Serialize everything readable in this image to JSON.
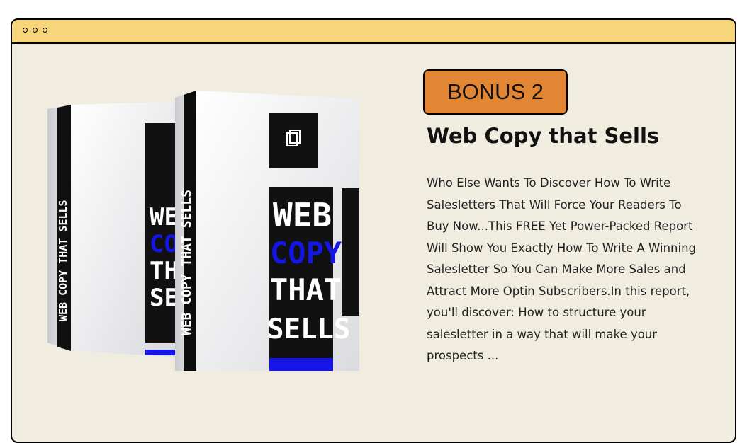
{
  "bonus": {
    "label": "BONUS 2",
    "title": "Web Copy that Sells",
    "description": "Who Else Wants To Discover How To Write Salesletters That Will Force Your Readers To Buy Now...This FREE Yet Power-Packed Report Will Show You Exactly How To Write A Winning Salesletter So You Can Make More Sales and Attract More Optin Subscribers.In this report, you'll discover: How to structure your salesletter in a way that will make your prospects ..."
  },
  "box": {
    "spine_text": "WEB COPY THAT SELLS",
    "title_words": [
      "WEB",
      "COPY",
      "THAT",
      "SELLS"
    ],
    "accent_color": "#1515e6"
  },
  "theme": {
    "titlebar_color": "#f7d57a",
    "badge_color": "#e38634",
    "panel_color": "#f0ede0"
  }
}
